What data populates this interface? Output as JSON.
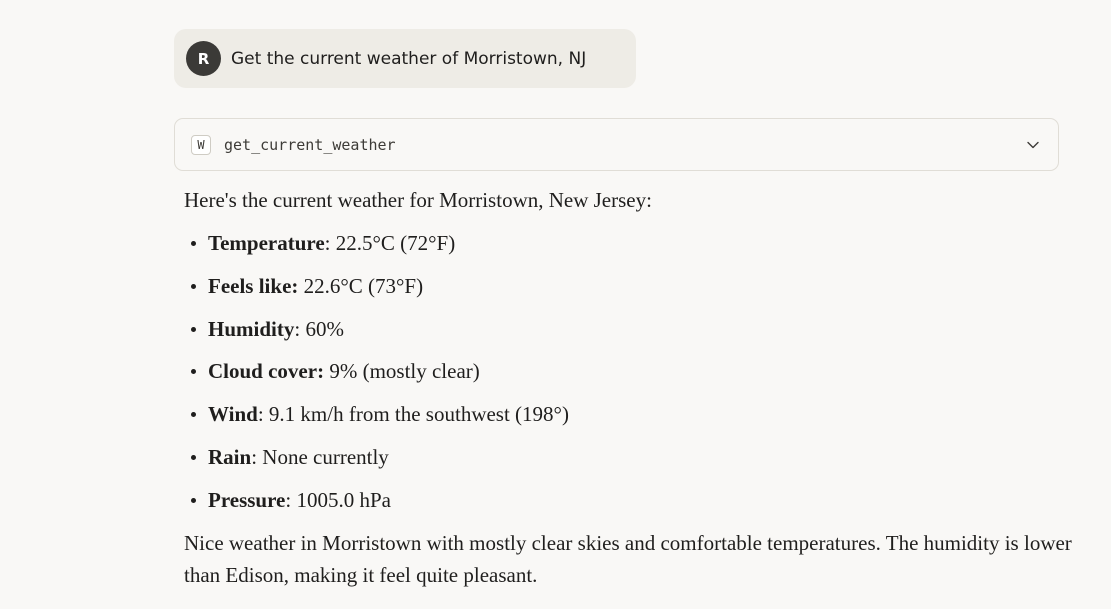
{
  "user_message": {
    "avatar_initial": "R",
    "text": "Get the current weather of Morristown, NJ"
  },
  "tool_call": {
    "icon_letter": "W",
    "name": "get_current_weather",
    "chevron_icon": "chevron-down-icon"
  },
  "response": {
    "intro": "Here's the current weather for Morristown, New Jersey:",
    "bullets": [
      {
        "label": "Temperature",
        "value": ": 22.5°C (72°F)"
      },
      {
        "label": "Feels like:",
        "value": " 22.6°C (73°F)"
      },
      {
        "label": "Humidity",
        "value": ": 60%"
      },
      {
        "label": "Cloud cover:",
        "value": " 9% (mostly clear)"
      },
      {
        "label": "Wind",
        "value": ": 9.1 km/h from the southwest (198°)"
      },
      {
        "label": "Rain",
        "value": ": None currently"
      },
      {
        "label": "Pressure",
        "value": ": 1005.0 hPa"
      }
    ],
    "summary": "Nice weather in Morristown with mostly clear skies and comfortable temperatures. The humidity is lower than Edison, making it feel quite pleasant."
  },
  "colors": {
    "background": "#f9f8f6",
    "user_bubble": "#eeece6",
    "avatar": "#3b3a37",
    "text": "#1f1e1d"
  }
}
